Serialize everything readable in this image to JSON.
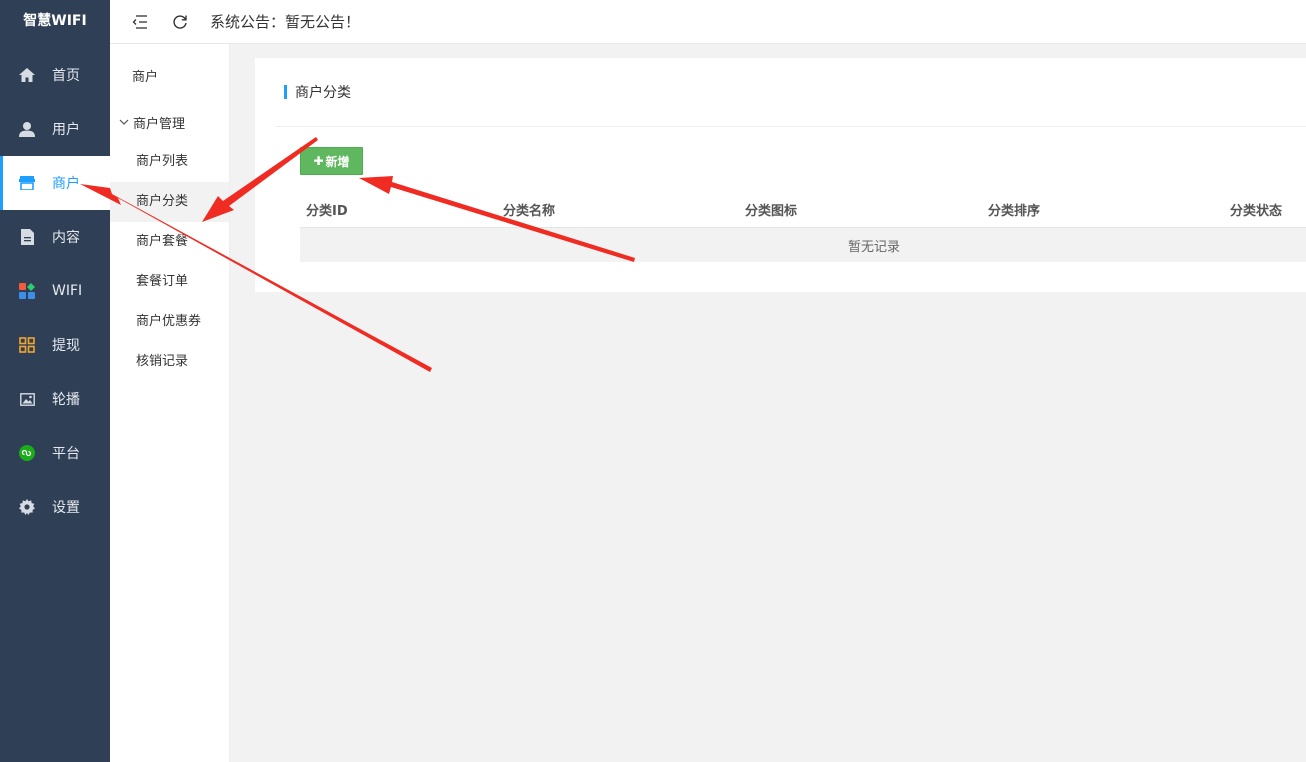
{
  "brand": "智慧WIFI",
  "sidebar": {
    "items": [
      {
        "label": "首页",
        "icon": "home-icon"
      },
      {
        "label": "用户",
        "icon": "user-icon"
      },
      {
        "label": "商户",
        "icon": "store-icon",
        "active": true
      },
      {
        "label": "内容",
        "icon": "document-icon"
      },
      {
        "label": "WIFI",
        "icon": "apps-icon"
      },
      {
        "label": "提现",
        "icon": "grid-icon"
      },
      {
        "label": "轮播",
        "icon": "image-icon"
      },
      {
        "label": "平台",
        "icon": "mini-program-icon"
      },
      {
        "label": "设置",
        "icon": "gear-icon"
      }
    ]
  },
  "topbar": {
    "notice": "系统公告：暂无公告！"
  },
  "subnav": {
    "title": "商户",
    "group": "商户管理",
    "items": [
      "商户列表",
      "商户分类",
      "商户套餐",
      "套餐订单",
      "商户优惠券",
      "核销记录"
    ]
  },
  "main": {
    "card_title": "商户分类",
    "add_button": "新增",
    "table": {
      "columns": [
        "分类ID",
        "分类名称",
        "分类图标",
        "分类排序",
        "分类状态"
      ],
      "empty_text": "暂无记录"
    }
  },
  "colors": {
    "sidebar_bg": "#2f4056",
    "accent": "#1e9fff",
    "add_button": "#5fb85f",
    "annotation_arrow": "#f02b22"
  }
}
